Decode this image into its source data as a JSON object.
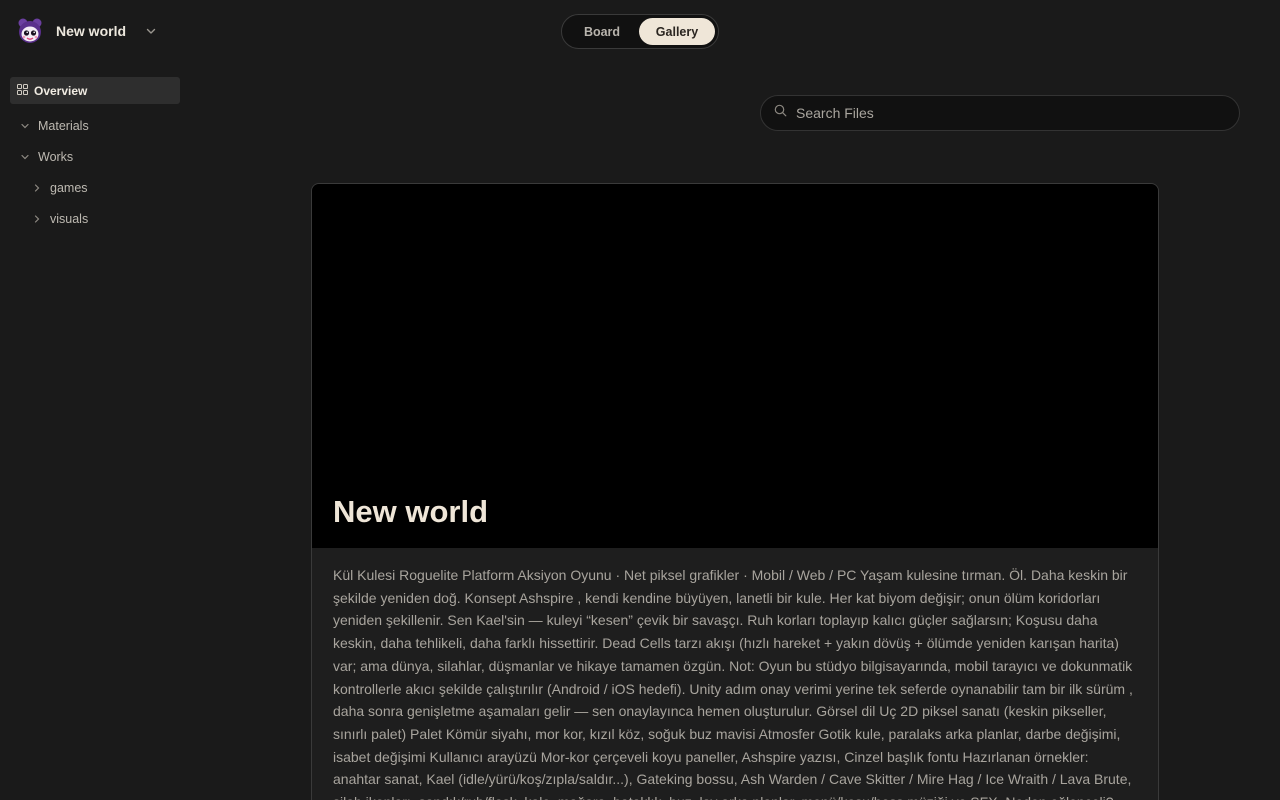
{
  "workspace": {
    "name": "New world"
  },
  "sidebar": {
    "overview_label": "Overview",
    "items": [
      {
        "label": "Materials",
        "expanded": true,
        "level": 1
      },
      {
        "label": "Works",
        "expanded": true,
        "level": 1
      },
      {
        "label": "games",
        "expanded": false,
        "level": 2
      },
      {
        "label": "visuals",
        "expanded": false,
        "level": 2
      }
    ]
  },
  "view_toggle": {
    "board_label": "Board",
    "gallery_label": "Gallery",
    "active": "Gallery"
  },
  "search": {
    "placeholder": "Search Files",
    "value": ""
  },
  "card": {
    "title": "New world",
    "description": "Kül Kulesi Roguelite Platform Aksiyon Oyunu · Net piksel grafikler · Mobil / Web / PC Yaşam kulesine tırman. Öl. Daha keskin bir şekilde yeniden doğ. Konsept Ashspire , kendi kendine büyüyen, lanetli bir kule. Her kat biyom değişir; onun ölüm koridorları yeniden şekillenir. Sen Kael'sin — kuleyi “kesen” çevik bir savaşçı. Ruh korları toplayıp kalıcı güçler sağlarsın; Koşusu daha keskin, daha tehlikeli, daha farklı hissettirir. Dead Cells tarzı akışı (hızlı hareket + yakın dövüş + ölümde yeniden karışan harita) var; ama dünya, silahlar, düşmanlar ve hikaye tamamen özgün. Not: Oyun bu stüdyo bilgisayarında, mobil tarayıcı ve dokunmatik kontrollerle akıcı şekilde çalıştırılır (Android / iOS hedefi). Unity adım onay verimi yerine tek seferde oynanabilir tam bir ilk sürüm , daha sonra genişletme aşamaları gelir — sen onaylayınca hemen oluşturulur. Görsel dil Uç 2D piksel sanatı (keskin pikseller, sınırlı palet) Palet Kömür siyahı, mor kor, kızıl köz, soğuk buz mavisi Atmosfer Gotik kule, paralaks arka planlar, darbe değişimi, isabet değişimi Kullanıcı arayüzü Mor-kor çerçeveli koyu paneller, Ashspire yazısı, Cinzel başlık fontu Hazırlanan örnekler: anahtar sanat, Kael (idle/yürü/koş/zıpla/saldır...), Gateking bossu, Ash Warden / Cave Skitter / Mire Hag / Ice Wraith / Lava Brute, silah ikonları, sandık/rub/flask, kale, mağara, bataklık, buz, lav arka planlar, menü/koşu/boss müziği ve SFX. Neden eğlenceli? (çekirdek döngüsü)"
  },
  "colors": {
    "background": "#1a1a1a",
    "active_nav": "#2e2e2e",
    "toggle_active": "#efe6d8",
    "cover": "#000000",
    "title": "#efe6d8"
  },
  "icons": {
    "workspace": "workspace-avatar-icon",
    "workspace_menu": "chevron-down-icon",
    "overview": "grid-icon",
    "expanded": "chevron-down-icon",
    "collapsed": "chevron-right-icon",
    "search": "search-icon"
  }
}
